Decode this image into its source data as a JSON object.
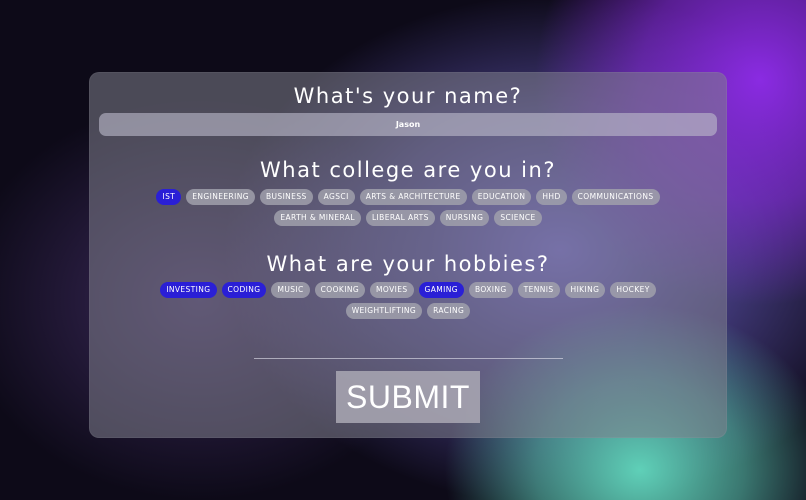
{
  "name_section": {
    "heading": "What's your name?",
    "value": "Jason"
  },
  "college_section": {
    "heading": "What college are you in?",
    "options": [
      {
        "label": "IST",
        "selected": true
      },
      {
        "label": "ENGINEERING",
        "selected": false
      },
      {
        "label": "BUSINESS",
        "selected": false
      },
      {
        "label": "AGSCI",
        "selected": false
      },
      {
        "label": "ARTS & ARCHITECTURE",
        "selected": false
      },
      {
        "label": "EDUCATION",
        "selected": false
      },
      {
        "label": "HHD",
        "selected": false
      },
      {
        "label": "COMMUNICATIONS",
        "selected": false
      },
      {
        "label": "EARTH & MINERAL",
        "selected": false
      },
      {
        "label": "LIBERAL ARTS",
        "selected": false
      },
      {
        "label": "NURSING",
        "selected": false
      },
      {
        "label": "SCIENCE",
        "selected": false
      }
    ]
  },
  "hobbies_section": {
    "heading": "What are your hobbies?",
    "options": [
      {
        "label": "INVESTING",
        "selected": true
      },
      {
        "label": "CODING",
        "selected": true
      },
      {
        "label": "MUSIC",
        "selected": false
      },
      {
        "label": "COOKING",
        "selected": false
      },
      {
        "label": "MOVIES",
        "selected": false
      },
      {
        "label": "GAMING",
        "selected": true
      },
      {
        "label": "BOXING",
        "selected": false
      },
      {
        "label": "TENNIS",
        "selected": false
      },
      {
        "label": "HIKING",
        "selected": false
      },
      {
        "label": "HOCKEY",
        "selected": false
      },
      {
        "label": "WEIGHTLIFTING",
        "selected": false
      },
      {
        "label": "RACING",
        "selected": false
      }
    ]
  },
  "submit_label": "SUBMIT",
  "colors": {
    "selected_chip": "#2a1fd6",
    "unselected_chip": "#a0a0ac"
  }
}
